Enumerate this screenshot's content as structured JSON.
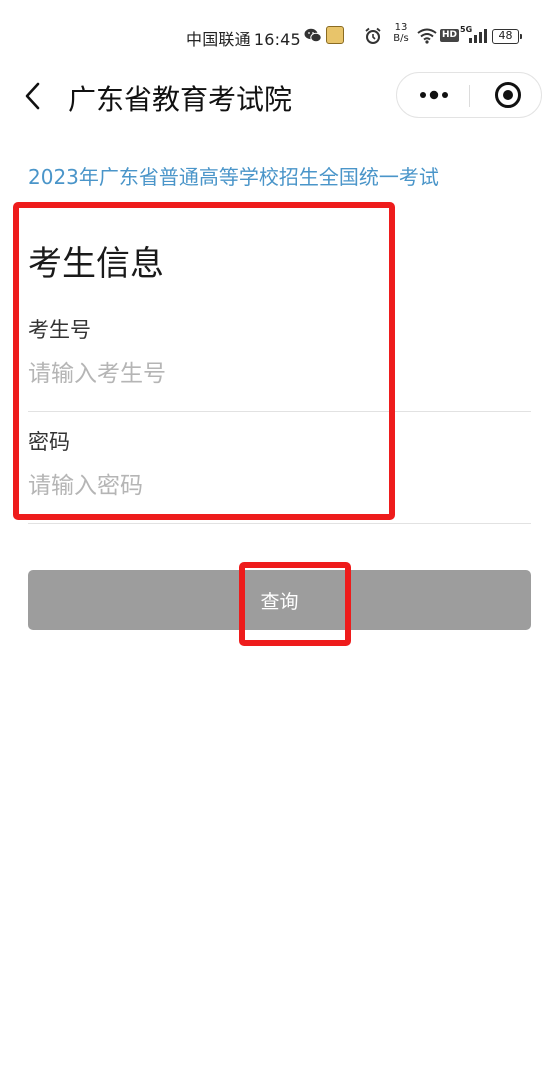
{
  "status_bar": {
    "carrier": "中国联通",
    "time": "16:45",
    "net_speed_value": "13",
    "net_speed_unit": "B/s",
    "hd_label": "HD",
    "network_label": "5G",
    "battery_level": "48"
  },
  "nav": {
    "title": "广东省教育考试院"
  },
  "content": {
    "exam_title": "2023年广东省普通高等学校招生全国统一考试",
    "section_heading": "考生信息",
    "candidate_id": {
      "label": "考生号",
      "placeholder": "请输入考生号",
      "value": ""
    },
    "password": {
      "label": "密码",
      "placeholder": "请输入密码",
      "value": ""
    },
    "query_label": "查询"
  },
  "colors": {
    "exam_title": "#4a95c9",
    "button_bg": "#9d9d9d",
    "highlight": "#ee1c1c"
  }
}
